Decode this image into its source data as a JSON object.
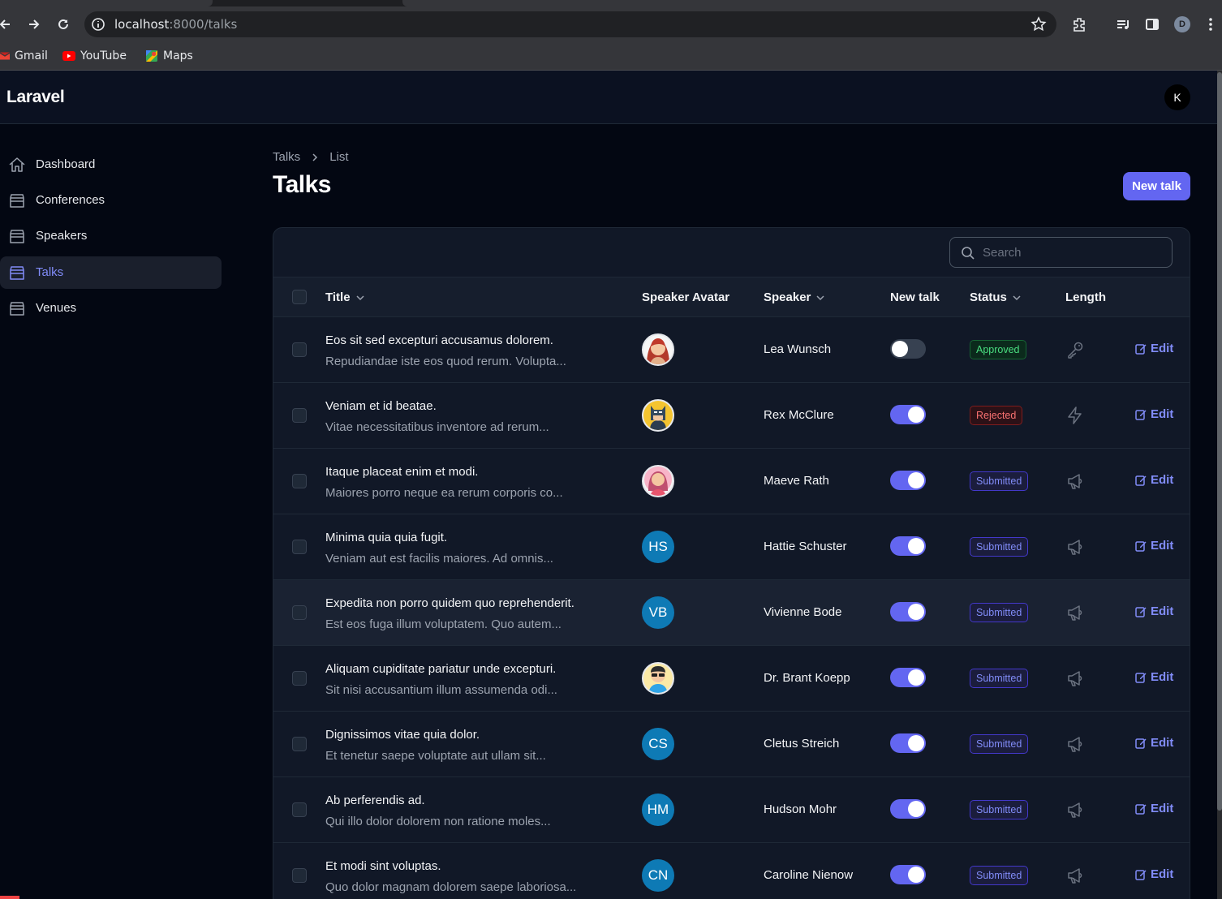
{
  "browser": {
    "url_host": "localhost",
    "url_path": ":8000/talks",
    "bookmarks": [
      {
        "label": "Gmail",
        "icon": "gmail-icon"
      },
      {
        "label": "YouTube",
        "icon": "youtube-icon"
      },
      {
        "label": "Maps",
        "icon": "maps-icon"
      }
    ],
    "profile_initial": "D"
  },
  "app": {
    "brand": "Laravel",
    "user_initial": "K",
    "accent_color": "#6366f1"
  },
  "sidebar": {
    "items": [
      {
        "label": "Dashboard",
        "icon": "home-icon",
        "active": false
      },
      {
        "label": "Conferences",
        "icon": "box-icon",
        "active": false
      },
      {
        "label": "Speakers",
        "icon": "box-icon",
        "active": false
      },
      {
        "label": "Talks",
        "icon": "box-icon",
        "active": true
      },
      {
        "label": "Venues",
        "icon": "box-icon",
        "active": false
      }
    ]
  },
  "breadcrumb": {
    "parent": "Talks",
    "current": "List"
  },
  "page": {
    "title": "Talks",
    "new_button": "New talk"
  },
  "search": {
    "placeholder": "Search"
  },
  "table": {
    "columns": {
      "title": "Title",
      "speaker_avatar": "Speaker Avatar",
      "speaker": "Speaker",
      "new_talk": "New talk",
      "status": "Status",
      "length": "Length"
    },
    "edit_label": "Edit",
    "rows": [
      {
        "title": "Eos sit sed excepturi accusamus dolorem.",
        "desc": "Repudiandae iste eos quod rerum. Volupta...",
        "avatar": "woman-red-hair-avatar",
        "initials": "",
        "speaker": "Lea Wunsch",
        "new_talk": false,
        "status": "Approved",
        "length_icon": "key-icon"
      },
      {
        "title": "Veniam et id beatae.",
        "desc": "Vitae necessitatibus inventore ad rerum...",
        "avatar": "batman-avatar",
        "initials": "",
        "speaker": "Rex McClure",
        "new_talk": true,
        "status": "Rejected",
        "length_icon": "bolt-icon"
      },
      {
        "title": "Itaque placeat enim et modi.",
        "desc": "Maiores porro neque ea rerum corporis co...",
        "avatar": "woman-pink-avatar",
        "initials": "",
        "speaker": "Maeve Rath",
        "new_talk": true,
        "status": "Submitted",
        "length_icon": "megaphone-icon"
      },
      {
        "title": "Minima quia quia fugit.",
        "desc": "Veniam aut est facilis maiores. Ad omnis...",
        "avatar": "",
        "initials": "HS",
        "speaker": "Hattie Schuster",
        "new_talk": true,
        "status": "Submitted",
        "length_icon": "megaphone-icon"
      },
      {
        "title": "Expedita non porro quidem quo reprehenderit.",
        "desc": "Est eos fuga illum voluptatem. Quo autem...",
        "avatar": "",
        "initials": "VB",
        "speaker": "Vivienne Bode",
        "new_talk": true,
        "status": "Submitted",
        "length_icon": "megaphone-icon"
      },
      {
        "title": "Aliquam cupiditate pariatur unde excepturi.",
        "desc": "Sit nisi accusantium illum assumenda odi...",
        "avatar": "man-sunglasses-avatar",
        "initials": "",
        "speaker": "Dr. Brant Koepp",
        "new_talk": true,
        "status": "Submitted",
        "length_icon": "megaphone-icon"
      },
      {
        "title": "Dignissimos vitae quia dolor.",
        "desc": "Et tenetur saepe voluptate aut ullam sit...",
        "avatar": "",
        "initials": "CS",
        "speaker": "Cletus Streich",
        "new_talk": true,
        "status": "Submitted",
        "length_icon": "megaphone-icon"
      },
      {
        "title": "Ab perferendis ad.",
        "desc": "Qui illo dolor dolorem non ratione moles...",
        "avatar": "",
        "initials": "HM",
        "speaker": "Hudson Mohr",
        "new_talk": true,
        "status": "Submitted",
        "length_icon": "megaphone-icon"
      },
      {
        "title": "Et modi sint voluptas.",
        "desc": "Quo dolor magnam dolorem saepe laboriosa...",
        "avatar": "",
        "initials": "CN",
        "speaker": "Caroline Nienow",
        "new_talk": true,
        "status": "Submitted",
        "length_icon": "megaphone-icon"
      }
    ]
  }
}
